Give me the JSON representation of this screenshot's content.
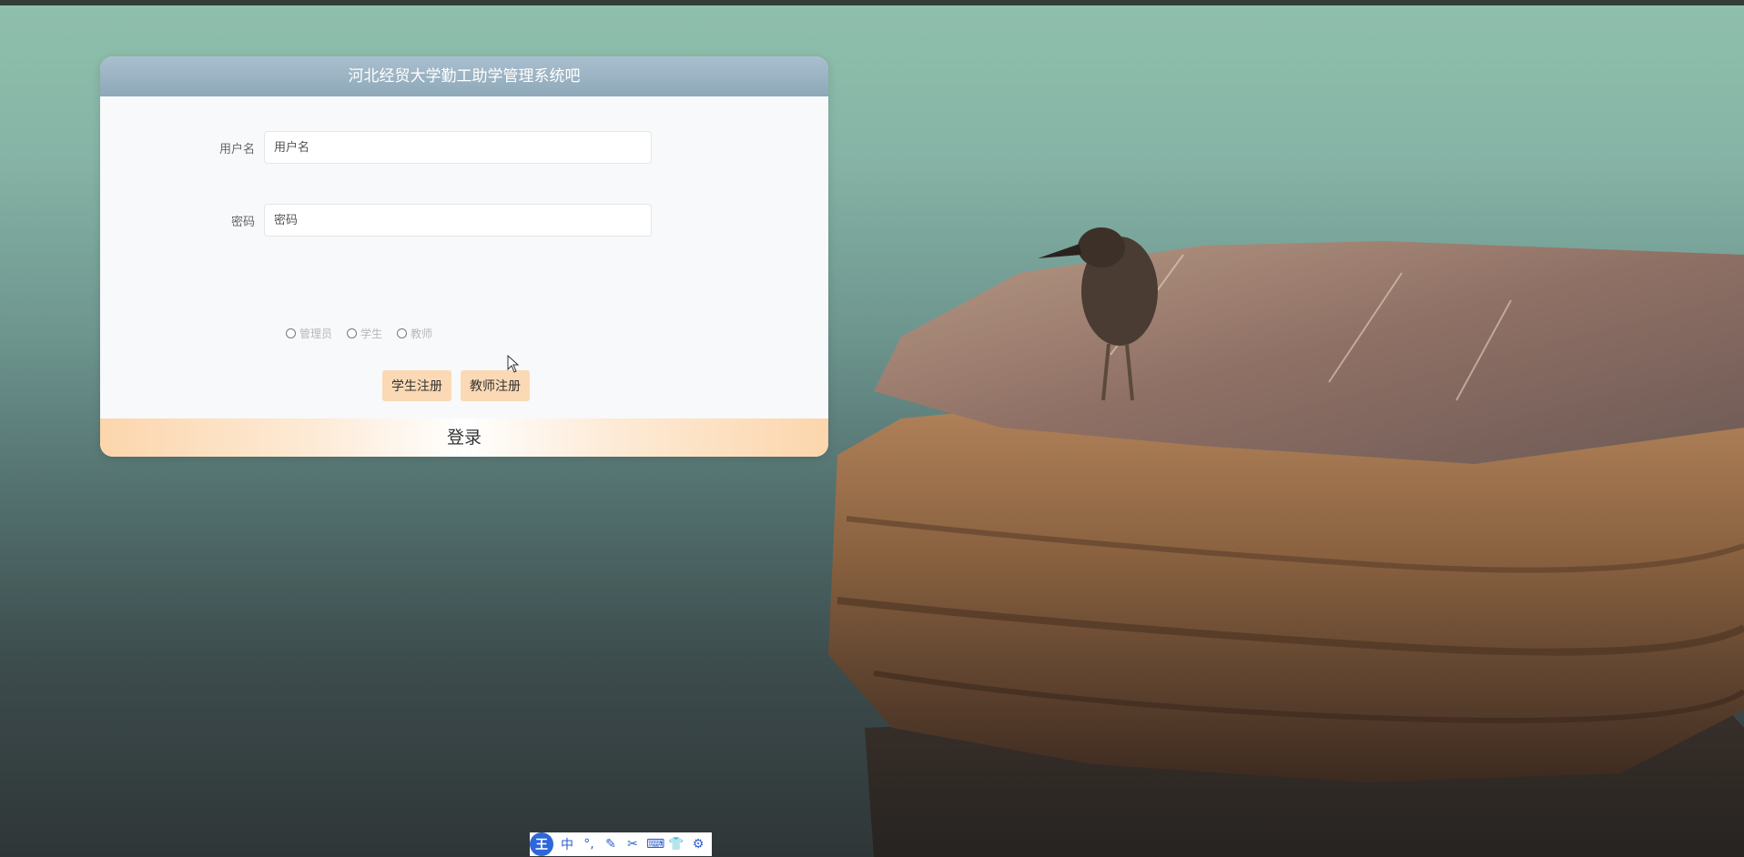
{
  "app": {
    "title": "河北经贸大学勤工助学管理系统吧"
  },
  "form": {
    "username": {
      "label": "用户名",
      "placeholder": "用户名",
      "value": ""
    },
    "password": {
      "label": "密码",
      "placeholder": "密码",
      "value": ""
    },
    "roles": [
      {
        "label": "管理员",
        "checked": false
      },
      {
        "label": "学生",
        "checked": false
      },
      {
        "label": "教师",
        "checked": false
      }
    ],
    "register_buttons": [
      {
        "label": "学生注册"
      },
      {
        "label": "教师注册"
      }
    ],
    "login_label": "登录"
  },
  "ime_toolbar": {
    "brand": "王",
    "items": [
      {
        "icon": "chinese-mode-icon",
        "glyph": "中"
      },
      {
        "icon": "punctuation-icon",
        "glyph": "°,"
      },
      {
        "icon": "pen-icon",
        "glyph": "✎"
      },
      {
        "icon": "scissors-icon",
        "glyph": "✂"
      },
      {
        "icon": "keyboard-icon",
        "glyph": "⌨"
      },
      {
        "icon": "skin-icon",
        "glyph": "👕"
      },
      {
        "icon": "settings-icon",
        "glyph": "⚙"
      }
    ]
  },
  "colors": {
    "header": "#8ea8b8",
    "register_button": "#fbd9b4",
    "login_bar": "#fcd6ac",
    "ime_accent": "#2d67d8"
  }
}
